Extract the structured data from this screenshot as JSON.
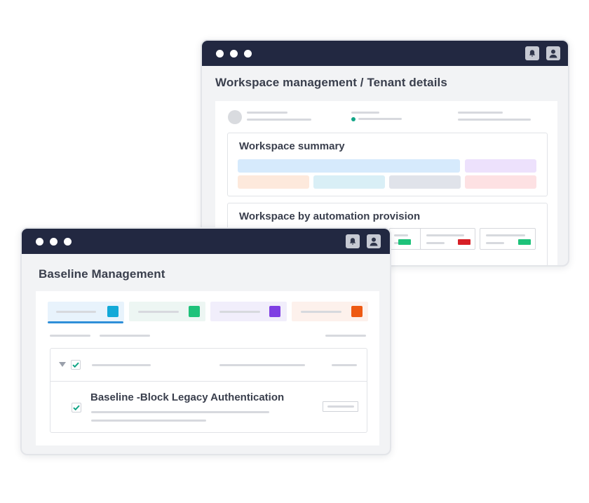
{
  "back_window": {
    "title": "Workspace management / Tenant details",
    "summary_card": {
      "title": "Workspace summary",
      "tile_colors": [
        "#d6eafc",
        "#ede1fc",
        "#fde9dc",
        "#d9eff6",
        "#e0e3ea",
        "#fde1e3"
      ]
    },
    "automation_card": {
      "title": "Workspace by automation provision",
      "badge_colors": [
        "#1ec27a",
        "#d71f26",
        "#1ec27a"
      ]
    },
    "status_dot_color": "#12a587"
  },
  "front_window": {
    "title": "Baseline Management",
    "tabs": [
      {
        "bg": "#e8f3fc",
        "accent": "#12a9d8",
        "active": true
      },
      {
        "bg": "#edf6f3",
        "accent": "#1ec27a",
        "active": false
      },
      {
        "bg": "#f1eefb",
        "accent": "#7f3fe3",
        "active": false
      },
      {
        "bg": "#fdf1ec",
        "accent": "#ee5a13",
        "active": false
      }
    ],
    "active_tab_underline_color": "#2f8fd8",
    "baseline_item": {
      "title": "Baseline -Block Legacy Authentication"
    },
    "check_color": "#12a587"
  },
  "icons": {
    "bell": "bell-icon",
    "user": "user-icon"
  }
}
